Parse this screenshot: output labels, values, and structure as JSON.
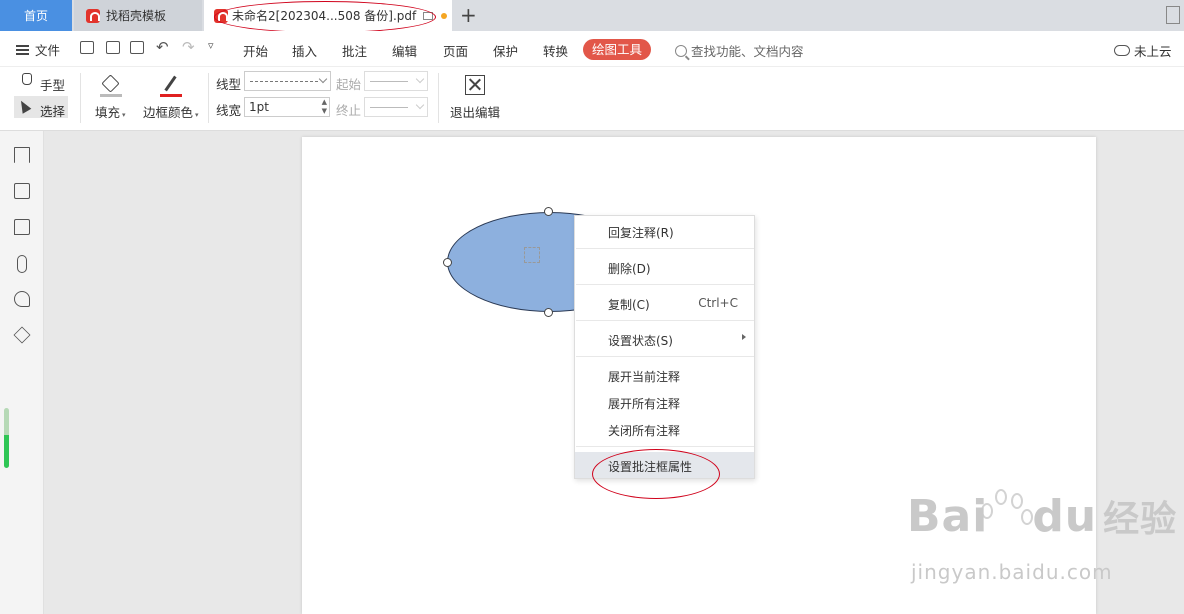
{
  "tabs": {
    "home": "首页",
    "templates": "找稻壳模板",
    "document": "未命名2[202304...508 备份].pdf",
    "add": "+"
  },
  "menubar": {
    "file": "文件",
    "items": [
      "开始",
      "插入",
      "批注",
      "编辑",
      "页面",
      "保护",
      "转换"
    ],
    "active_tool": "绘图工具",
    "search_placeholder": "查找功能、文档内容",
    "cloud": "未上云"
  },
  "toolbar": {
    "hand": "手型",
    "select": "选择",
    "fill": "填充",
    "border_color": "边框颜色",
    "line_type_label": "线型",
    "line_width_label": "线宽",
    "line_width_value": "1pt",
    "start_label": "起始",
    "end_label": "终止",
    "exit_edit": "退出编辑"
  },
  "sidebar": {
    "icons": [
      "bookmark-icon",
      "image-icon",
      "comment-icon",
      "attachment-icon",
      "signature-icon",
      "layers-icon"
    ]
  },
  "context_menu": {
    "items": [
      {
        "label": "回复注释(R)"
      },
      {
        "label": "删除(D)"
      },
      {
        "label": "复制(C)",
        "shortcut": "Ctrl+C"
      },
      {
        "label": "设置状态(S)",
        "submenu": true
      },
      {
        "label": "展开当前注释"
      },
      {
        "label": "展开所有注释"
      },
      {
        "label": "关闭所有注释"
      },
      {
        "label": "设置批注框属性",
        "highlighted": true
      }
    ]
  },
  "watermark": {
    "brand": "Bai",
    "brand2": "du",
    "cn": "经验",
    "url": "jingyan.baidu.com"
  },
  "colors": {
    "active_tool_bg": "#e25749",
    "home_tab_bg": "#4a90e2",
    "shape_fill": "#8db0de",
    "annotation_red": "#d0021b"
  }
}
